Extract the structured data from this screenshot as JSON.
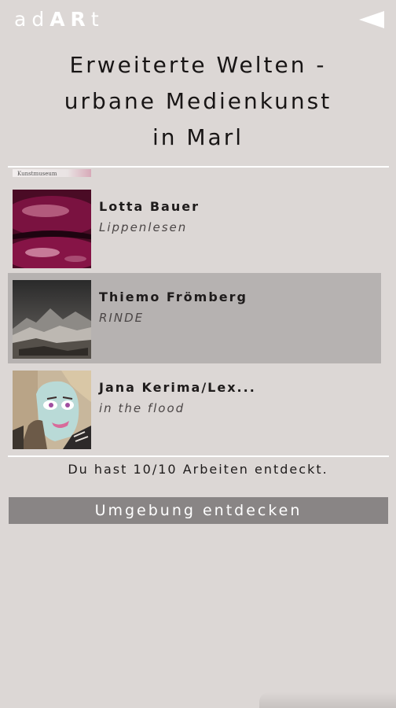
{
  "app": {
    "logo_parts": [
      "ad",
      "AR",
      "t"
    ],
    "back_icon": "back-triangle-icon"
  },
  "page": {
    "title_lines": [
      "Erweiterte Welten -",
      "urbane Medienkunst",
      "in Marl"
    ]
  },
  "list": {
    "partial_item_text": "Kunstmuseum",
    "items": [
      {
        "artist": "Lotta Bauer",
        "work": "Lippenlesen",
        "thumb": "lips-image",
        "selected": false
      },
      {
        "artist": "Thiemo Frömberg",
        "work": "RINDE",
        "thumb": "landscape-image",
        "selected": true
      },
      {
        "artist": "Jana Kerima/Lex...",
        "work": "in the flood",
        "thumb": "illustrated-face-image",
        "selected": false
      }
    ]
  },
  "status": {
    "text": "Du hast 10/10 Arbeiten entdeckt."
  },
  "actions": {
    "explore_label": "Umgebung entdecken"
  },
  "colors": {
    "background": "#dcd7d5",
    "selected_row": "#b6b2b1",
    "button": "#898585",
    "divider": "#ffffff"
  }
}
